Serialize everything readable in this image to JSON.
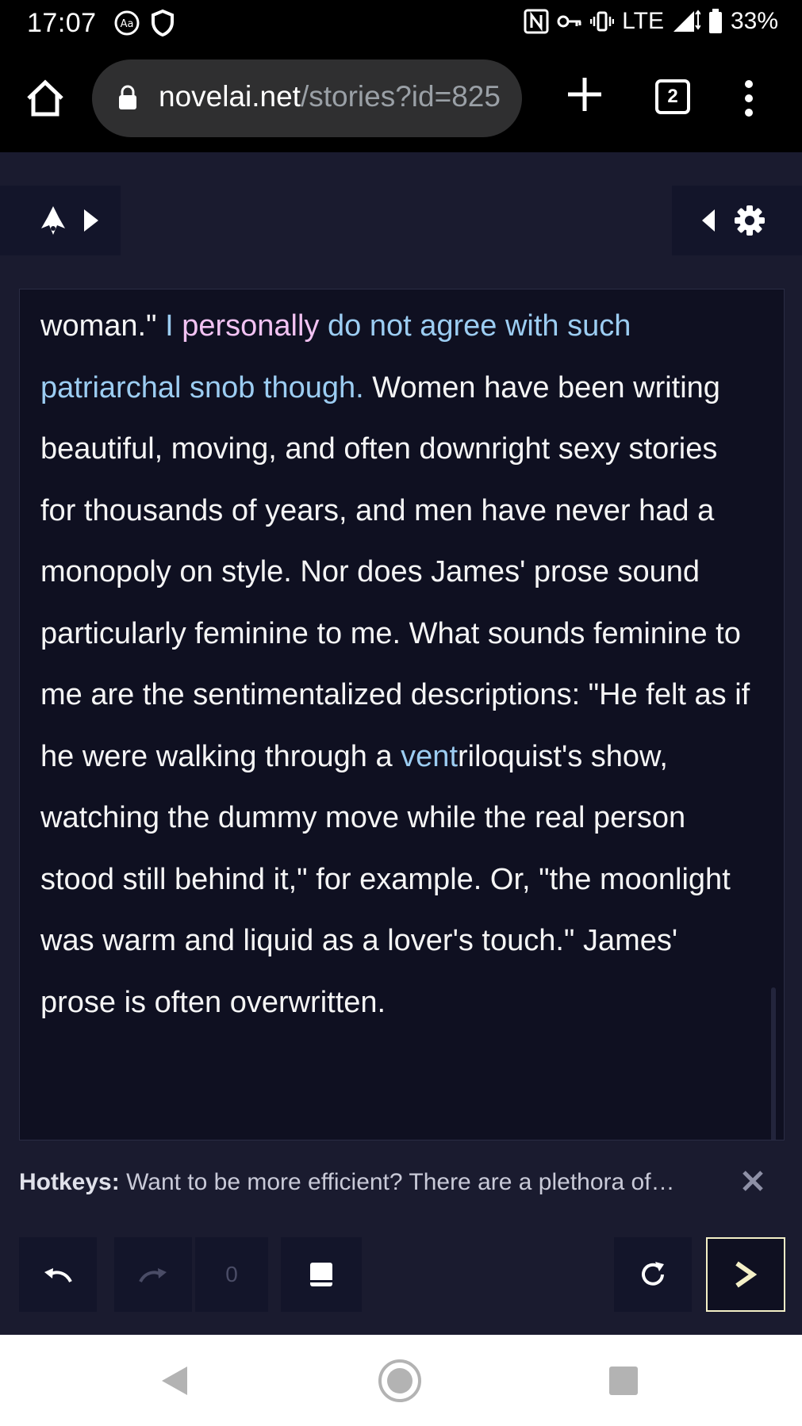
{
  "status_bar": {
    "time": "17:07",
    "network": "LTE",
    "battery": "33%",
    "icons": [
      "font-icon",
      "shield-icon",
      "nfc-icon",
      "key-icon",
      "vibrate-icon",
      "signal-icon",
      "battery-icon"
    ]
  },
  "browser": {
    "url_host": "novelai.net",
    "url_path": "/stories?id=825",
    "tab_count": "2"
  },
  "story": {
    "segments": [
      {
        "text": "woman.\" ",
        "style": "normal"
      },
      {
        "text": "I ",
        "style": "blue"
      },
      {
        "text": "personally",
        "style": "pink"
      },
      {
        "text": " do not agree with such patriarchal snob though.",
        "style": "blue"
      },
      {
        "text": " Women have been writing beautiful, moving, and often downright sexy stories for thousands of years, and men have never had a monopoly on style. Nor does James' prose sound particularly feminine to me. What sounds feminine to me are the sentimentalized descriptions: \"He felt as if he were walking through a ",
        "style": "normal"
      },
      {
        "text": "vent",
        "style": "blue"
      },
      {
        "text": "riloquist's show, watching the dummy move while the real person stood still behind it,\" for example. Or, \"the moonlight was warm and liquid as a lover's touch.\" James' prose is often overwritten.",
        "style": "normal"
      }
    ]
  },
  "tip": {
    "label": "Hotkeys:",
    "text": "Want to be more efficient? There are a plethora of…"
  },
  "controls": {
    "counter": "0"
  },
  "colors": {
    "app_bg": "#1a1b2f",
    "panel_bg": "#0f1021",
    "highlight_blue": "#9ccdf2",
    "highlight_pink": "#f2c2f2",
    "send_border": "#f4f0c7"
  }
}
